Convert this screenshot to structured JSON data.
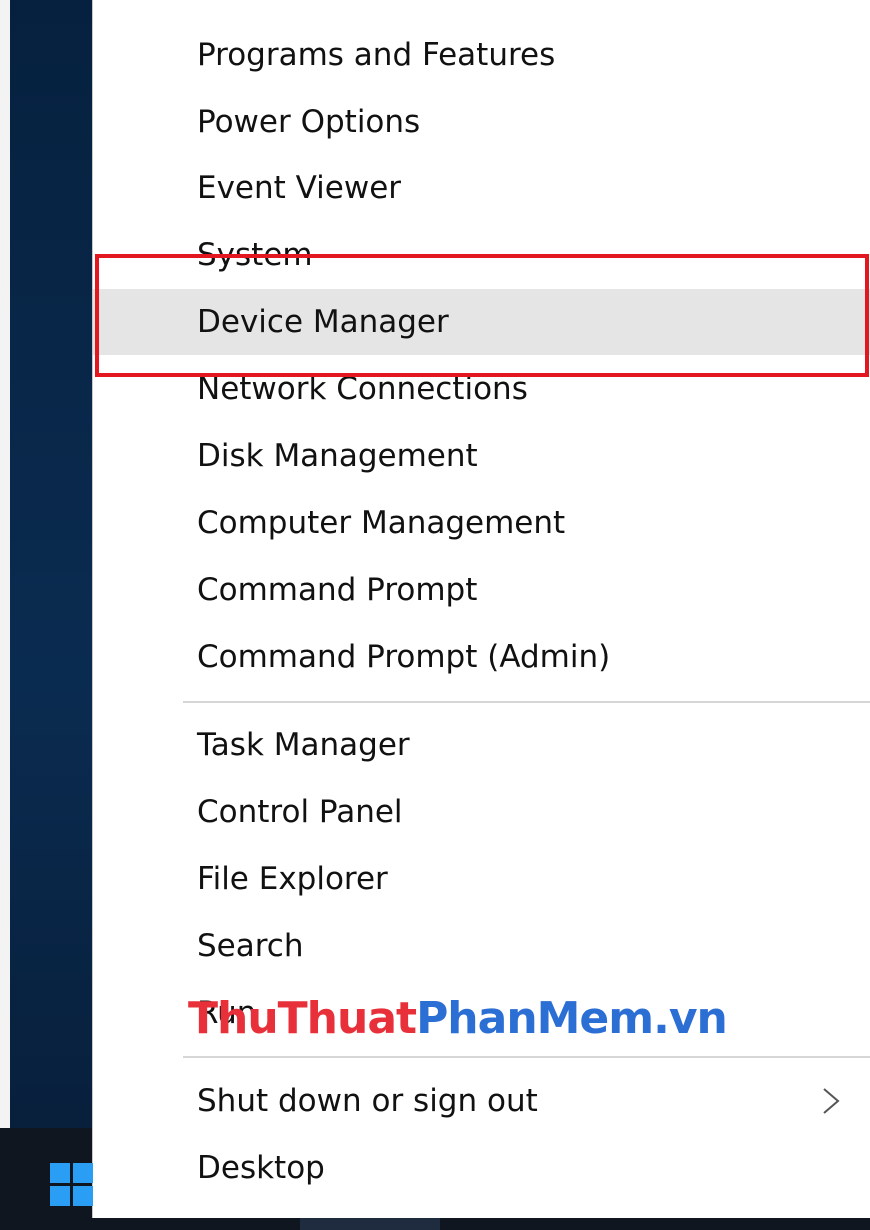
{
  "menu": {
    "items": [
      {
        "label": "Programs and Features"
      },
      {
        "label": "Power Options"
      },
      {
        "label": "Event Viewer"
      },
      {
        "label": "System"
      },
      {
        "label": "Device Manager"
      },
      {
        "label": "Network Connections"
      },
      {
        "label": "Disk Management"
      },
      {
        "label": "Computer Management"
      },
      {
        "label": "Command Prompt"
      },
      {
        "label": "Command Prompt (Admin)"
      },
      {
        "label": "Task Manager"
      },
      {
        "label": "Control Panel"
      },
      {
        "label": "File Explorer"
      },
      {
        "label": "Search"
      },
      {
        "label": "Run"
      },
      {
        "label": "Shut down or sign out"
      },
      {
        "label": "Desktop"
      }
    ],
    "highlighted_label": "Device Manager"
  },
  "watermark": {
    "part1": "ThuThuat",
    "part2": "PhanMem.vn"
  },
  "colors": {
    "highlight_box": "#e3171f",
    "hover_background": "#e5e5e5",
    "watermark_red": "#e8303a",
    "watermark_blue": "#2b6ed4",
    "start_icon": "#2a9df4"
  },
  "icons": {
    "submenu_arrow": "chevron-right-icon",
    "start_button": "windows-logo-icon"
  }
}
